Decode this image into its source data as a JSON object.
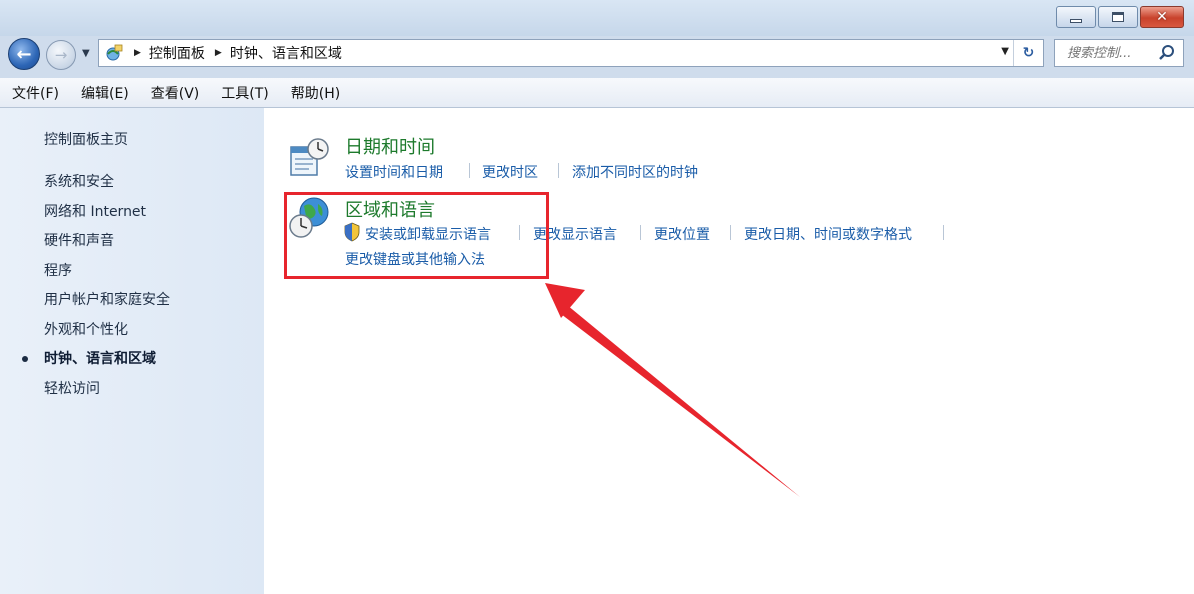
{
  "window": {
    "min_glyph": "minimize-icon",
    "max_glyph": "maximize-icon",
    "close_label": "✕"
  },
  "nav": {
    "back_glyph": "←",
    "forward_glyph": "→",
    "breadcrumb": [
      "控制面板",
      "时钟、语言和区域"
    ],
    "search_placeholder": "搜索控制...",
    "refresh_glyph": "↻"
  },
  "menu": [
    "文件(F)",
    "编辑(E)",
    "查看(V)",
    "工具(T)",
    "帮助(H)"
  ],
  "sidebar": {
    "home": "控制面板主页",
    "items": [
      "系统和安全",
      "网络和 Internet",
      "硬件和声音",
      "程序",
      "用户帐户和家庭安全",
      "外观和个性化",
      "时钟、语言和区域",
      "轻松访问"
    ],
    "current_index": 6
  },
  "categories": [
    {
      "title": "日期和时间",
      "links": [
        "设置时间和日期",
        "更改时区",
        "添加不同时区的时钟"
      ]
    },
    {
      "title": "区域和语言",
      "links": [
        "安装或卸载显示语言",
        "更改显示语言",
        "更改位置",
        "更改日期、时间或数字格式",
        "更改键盘或其他输入法"
      ]
    }
  ],
  "colors": {
    "annotation": "#e7252d",
    "link": "#1a5ca8",
    "category_title": "#1d7a2c"
  }
}
